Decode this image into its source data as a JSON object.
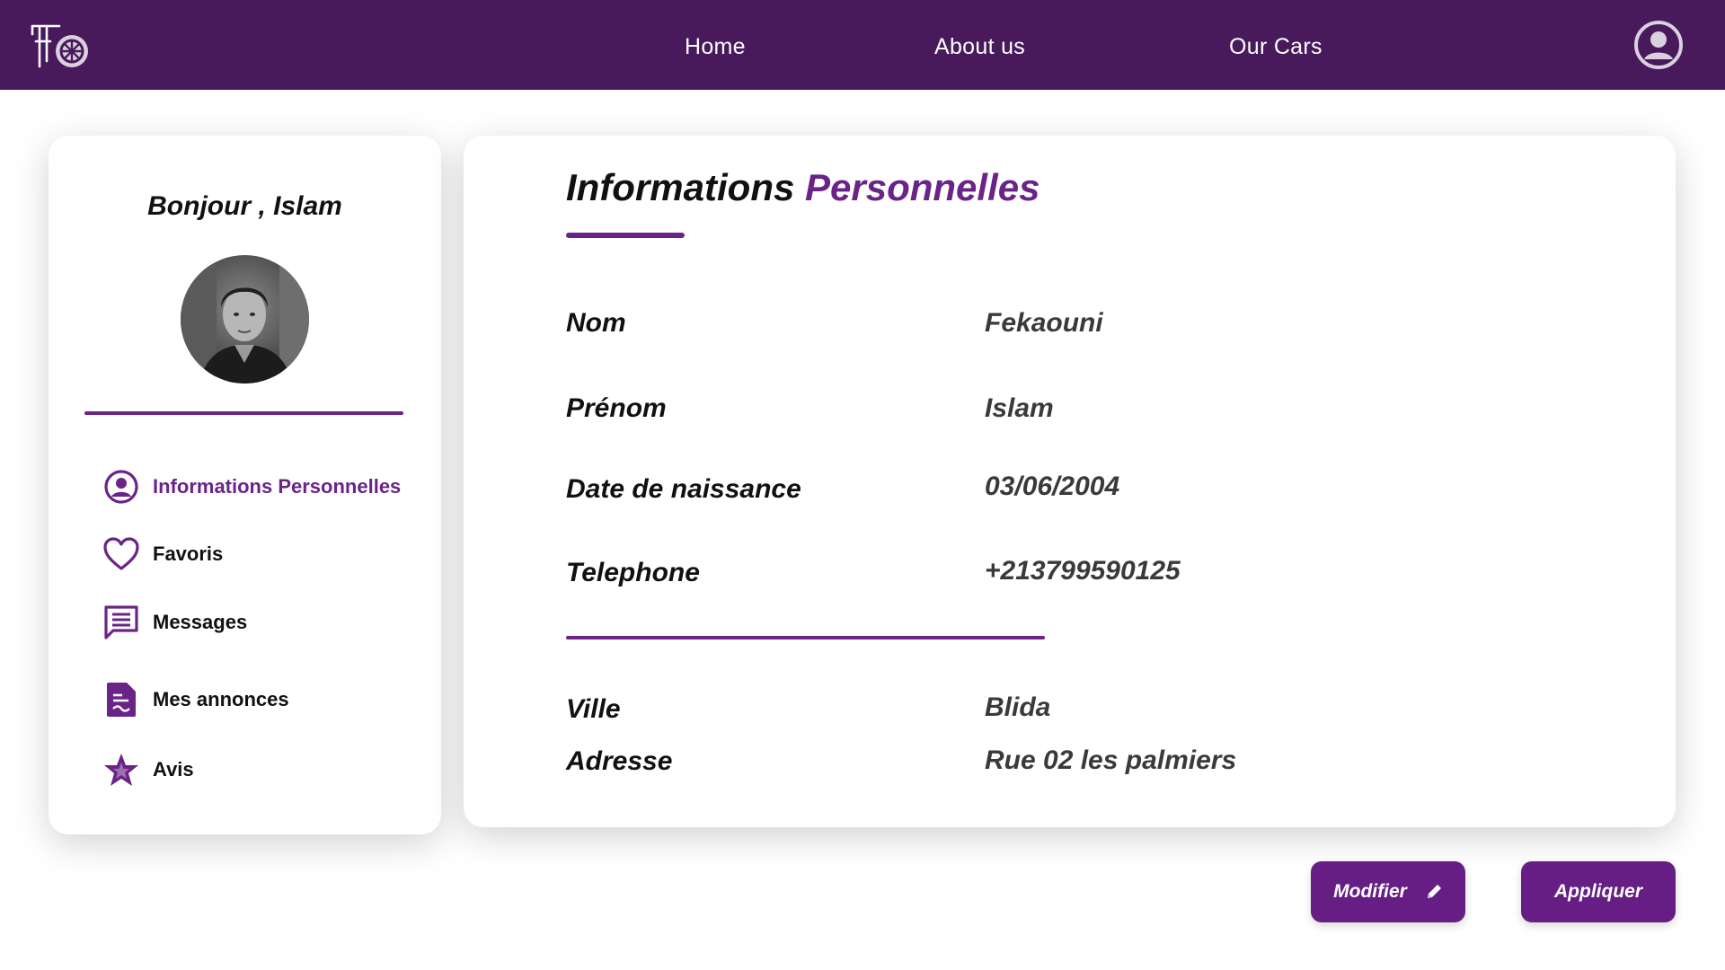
{
  "header": {
    "logo_icon": "car-wheel-logo-icon",
    "nav": [
      {
        "label": "Home"
      },
      {
        "label": "About us"
      },
      {
        "label": "Our Cars"
      }
    ],
    "profile_icon": "user-circle-icon"
  },
  "sidebar": {
    "greeting": "Bonjour , Islam",
    "avatar_icon": "user-avatar-photo",
    "items": [
      {
        "label": "Informations Personnelles",
        "icon": "user-circle-icon",
        "active": true
      },
      {
        "label": "Favoris",
        "icon": "heart-icon",
        "active": false
      },
      {
        "label": "Messages",
        "icon": "message-icon",
        "active": false
      },
      {
        "label": "Mes annonces",
        "icon": "document-icon",
        "active": false
      },
      {
        "label": "Avis",
        "icon": "star-icon",
        "active": false
      }
    ]
  },
  "main": {
    "title_part1": "Informations",
    "title_part2": "Personnelles",
    "fields": [
      {
        "label": "Nom",
        "value": "Fekaouni"
      },
      {
        "label": "Prénom",
        "value": "Islam"
      },
      {
        "label": "Date de naissance",
        "value": "03/06/2004"
      },
      {
        "label": "Telephone",
        "value": "+213799590125"
      },
      {
        "label": "Ville",
        "value": "Blida"
      },
      {
        "label": "Adresse",
        "value": "Rue 02 les palmiers"
      }
    ]
  },
  "actions": {
    "modify_label": "Modifier",
    "modify_icon": "pencil-icon",
    "apply_label": "Appliquer"
  },
  "colors": {
    "header_bg": "#481a5c",
    "accent": "#6a2487",
    "button_bg": "#661e84"
  }
}
